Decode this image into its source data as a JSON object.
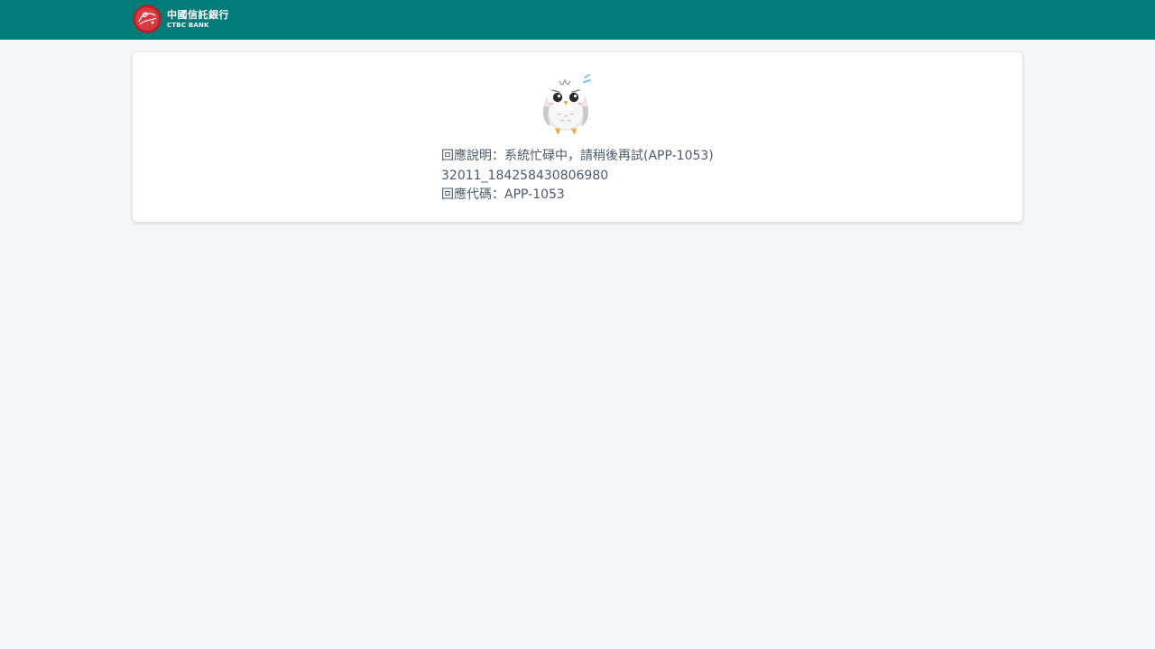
{
  "header": {
    "brand_name_zh": "中國信託銀行",
    "brand_name_en": "CTBC BANK",
    "background_color": "#007b78"
  },
  "logo": {
    "icon": "ctbc-logo-icon",
    "primary_color": "#d4202a"
  },
  "error_card": {
    "icon": "worried-owl-icon",
    "description_line": "回應說明：系統忙碌中，請稍後再試(APP-1053)",
    "trace_id": "32011_184258430806980",
    "code_line": "回應代碼：APP-1053"
  }
}
